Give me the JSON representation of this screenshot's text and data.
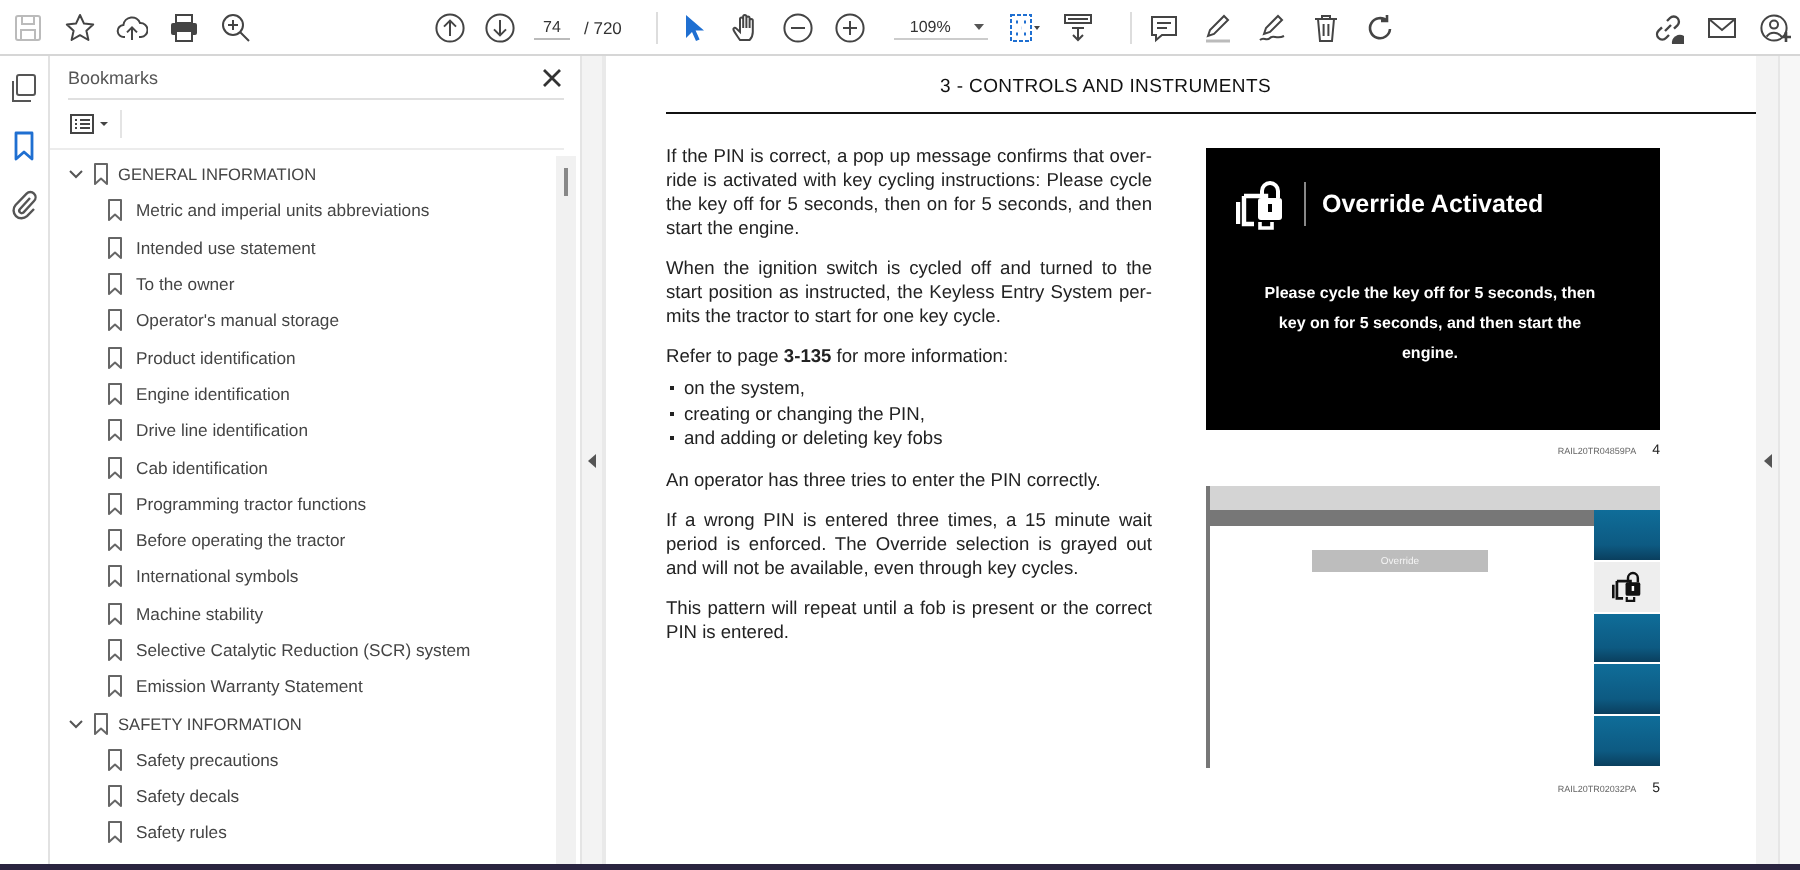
{
  "toolbar": {
    "file_buttons": [
      {
        "kind": "save",
        "disabled": true
      },
      {
        "kind": "star",
        "disabled": false
      },
      {
        "kind": "upload",
        "disabled": false
      },
      {
        "kind": "print",
        "disabled": false
      },
      {
        "kind": "find",
        "disabled": false
      }
    ],
    "page_nav": {
      "buttons": [
        {
          "kind": "up"
        },
        {
          "kind": "down"
        }
      ],
      "page": "74",
      "total": "/ 720"
    },
    "tools": [
      {
        "kind": "select",
        "selected": true
      },
      {
        "kind": "hand",
        "selected": false
      }
    ],
    "zoom": {
      "buttons": [
        {
          "kind": "minus"
        },
        {
          "kind": "plus"
        }
      ],
      "value": "109%"
    },
    "view_buttons": [
      {
        "kind": "fit"
      },
      {
        "kind": "scroll"
      }
    ],
    "edit_buttons": [
      {
        "kind": "comment"
      },
      {
        "kind": "pen"
      },
      {
        "kind": "sign"
      },
      {
        "kind": "trash"
      },
      {
        "kind": "rotate"
      }
    ],
    "share_buttons": [
      {
        "kind": "link"
      },
      {
        "kind": "mail"
      },
      {
        "kind": "account"
      }
    ]
  },
  "rail": [
    {
      "kind": "pages",
      "selected": false
    },
    {
      "kind": "bookmarks",
      "selected": true
    },
    {
      "kind": "attachments",
      "selected": false
    }
  ],
  "bookmarks_panel": {
    "title": "Bookmarks",
    "tree": [
      {
        "label": "GENERAL INFORMATION",
        "expanded": true,
        "children": [
          {
            "label": "Metric and imperial units abbreviations"
          },
          {
            "label": "Intended use statement"
          },
          {
            "label": "To the owner"
          },
          {
            "label": "Operator's manual storage"
          },
          {
            "label": "Product identification"
          },
          {
            "label": "Engine identification"
          },
          {
            "label": "Drive line identification"
          },
          {
            "label": "Cab identification"
          },
          {
            "label": "Programming tractor functions"
          },
          {
            "label": "Before operating the tractor"
          },
          {
            "label": "International symbols"
          },
          {
            "label": "Machine stability"
          },
          {
            "label": "Selective Catalytic Reduction (SCR) system"
          },
          {
            "label": "Emission Warranty Statement"
          }
        ]
      },
      {
        "label": "SAFETY INFORMATION",
        "expanded": true,
        "children": [
          {
            "label": "Safety precautions"
          },
          {
            "label": "Safety decals"
          },
          {
            "label": "Safety rules"
          }
        ]
      }
    ]
  },
  "document": {
    "header": "3 - CONTROLS AND INSTRUMENTS",
    "blocks": [
      {
        "kind": "paragraph",
        "lines": [
          "If the PIN is correct, a pop up message confirms that over-",
          "ride is activated with key cycling instructions: Please cycle",
          "the key off for 5 seconds, then on for 5 seconds, and then",
          "start the engine."
        ]
      },
      {
        "kind": "paragraph",
        "lines": [
          "When the ignition switch is cycled off and turned to the",
          "start position as instructed, the Keyless Entry System per-",
          "mits the tractor to start for one key cycle."
        ]
      },
      {
        "kind": "paragraph",
        "lines": [
          "Refer to page **3-135** for more information:"
        ]
      },
      {
        "kind": "bullets",
        "items": [
          "on the system,",
          "creating or changing the PIN,",
          "and adding or deleting key fobs"
        ]
      },
      {
        "kind": "paragraph",
        "lines": [
          "An operator has three tries to enter the PIN correctly."
        ]
      },
      {
        "kind": "paragraph",
        "lines": [
          "If a wrong PIN is entered three times, a 15 minute wait",
          "period is enforced.  The Override selection is grayed out",
          "and will not be available, even through key cycles."
        ]
      },
      {
        "kind": "paragraph",
        "lines": [
          "This pattern will repeat until a fob is present or the correct",
          "PIN is entered."
        ]
      }
    ],
    "figures": [
      {
        "kind": "popup",
        "title": "Override Activated",
        "message": "Please cycle the key off for 5 seconds, then key on for 5 seconds, and then start the engine.",
        "caption": "RAIL20TR04859PA",
        "number": "4"
      },
      {
        "kind": "screen",
        "button": "Override",
        "caption": "RAIL20TR02032PA",
        "number": "5"
      }
    ]
  }
}
